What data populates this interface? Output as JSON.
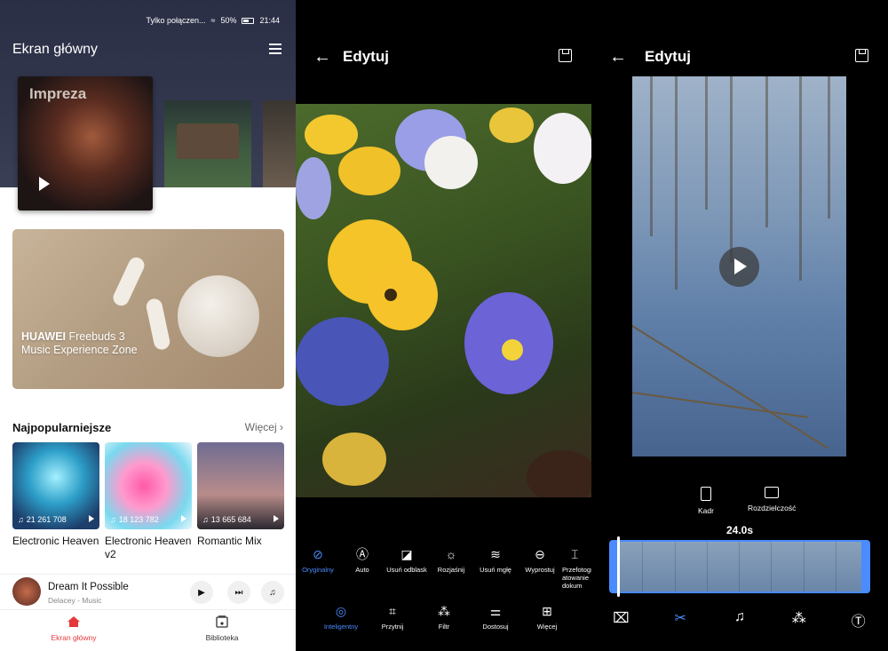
{
  "music": {
    "status": {
      "connection": "Tylko połączen...",
      "battery": "50%",
      "time": "21:44"
    },
    "title": "Ekran główny",
    "featured_label": "Impreza",
    "banner": {
      "brand": "HUAWEI",
      "line1": "Freebuds 3",
      "line2": "Music Experience Zone"
    },
    "section": {
      "title": "Najpopularniejsze",
      "more": "Więcej"
    },
    "playlists": [
      {
        "name": "Electronic Heaven",
        "plays": "21 261 708"
      },
      {
        "name": "Electronic Heaven v2",
        "plays": "18 123 782"
      },
      {
        "name": "Romantic Mix",
        "plays": "13 665 684"
      }
    ],
    "now_playing": {
      "song": "Dream It Possible",
      "artist": "Delacey - Music"
    },
    "nav": [
      {
        "label": "Ekran główny",
        "icon": "home-icon"
      },
      {
        "label": "Biblioteka",
        "icon": "library-icon"
      }
    ],
    "accent": "#e5383b"
  },
  "photo_edit": {
    "title": "Edytuj",
    "tools_row1": [
      {
        "label": "Oryginalny",
        "icon": "original-icon",
        "active": true
      },
      {
        "label": "Auto",
        "icon": "auto-icon"
      },
      {
        "label": "Usuń odblask",
        "icon": "deglare-icon"
      },
      {
        "label": "Rozjaśnij",
        "icon": "brighten-icon"
      },
      {
        "label": "Usuń mgłę",
        "icon": "dehaze-icon"
      },
      {
        "label": "Wyprostuj",
        "icon": "straighten-icon"
      },
      {
        "label": "Przefotografuj atowanie dokum",
        "icon": "document-icon"
      }
    ],
    "tools_row2": [
      {
        "label": "Inteligentny",
        "icon": "smart-icon",
        "active": true
      },
      {
        "label": "Przytnij",
        "icon": "crop-icon"
      },
      {
        "label": "Filtr",
        "icon": "filter-icon"
      },
      {
        "label": "Dostosuj",
        "icon": "adjust-icon"
      },
      {
        "label": "Więcej",
        "icon": "more-icon"
      }
    ],
    "accent": "#4a8cff"
  },
  "video_edit": {
    "title": "Edytuj",
    "options": [
      {
        "label": "Kadr",
        "icon": "frame-icon"
      },
      {
        "label": "Rozdzielczość",
        "icon": "resolution-icon"
      }
    ],
    "duration": "24.0s",
    "bottom_tabs": [
      "brush-icon",
      "scissors-icon",
      "music-icon",
      "filter-icon",
      "text-icon"
    ]
  }
}
